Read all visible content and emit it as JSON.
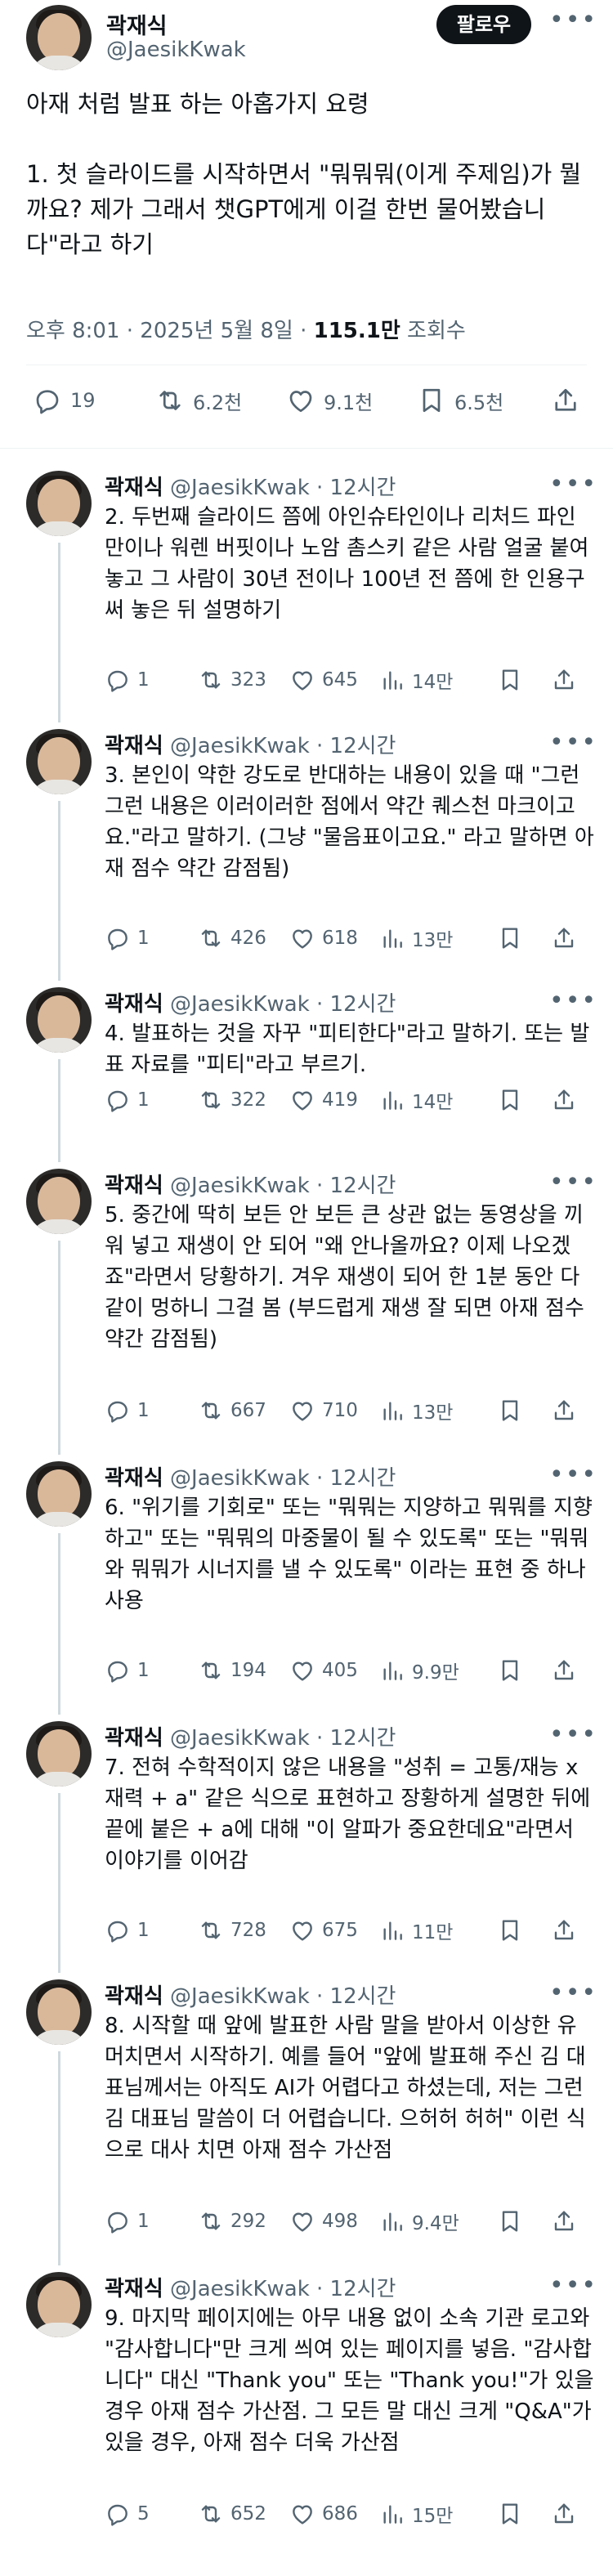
{
  "main_tweet": {
    "author_name": "곽재식",
    "author_handle": "@JaesikKwak",
    "follow_label": "팔로우",
    "text": "아재 처럼 발표 하는 아홉가지 요령\n\n1. 첫 슬라이드를 시작하면서 \"뭐뭐뭐(이게 주제임)가 뭘까요? 제가 그래서 챗GPT에게 이걸 한번 물어봤습니다\"라고 하기",
    "time": "오후 8:01 · 2025년 5월 8일 · ",
    "views": "115.1만",
    "views_label": " 조회수",
    "replies": "19",
    "retweets": "6.2천",
    "likes": "9.1천",
    "bookmarks": "6.5천"
  },
  "replies": [
    {
      "author_name": "곽재식",
      "meta": " @JaesikKwak · 12시간",
      "text": "2. 두번째 슬라이드 쯤에 아인슈타인이나 리처드 파인만이나 워렌 버핏이나 노암 촘스키 같은 사람 얼굴 붙여 놓고 그 사람이 30년 전이나 100년 전 쯤에 한 인용구 써 놓은 뒤 설명하기",
      "replies": "1",
      "retweets": "323",
      "likes": "645",
      "views": "14만"
    },
    {
      "author_name": "곽재식",
      "meta": " @JaesikKwak · 12시간",
      "text": "3. 본인이 약한 강도로 반대하는 내용이 있을 때 \"그런그런 내용은 이러이러한 점에서 약간 퀘스천 마크이고요.\"라고 말하기. (그냥 \"물음표이고요.\" 라고 말하면 아재 점수 약간 감점됨)",
      "replies": "1",
      "retweets": "426",
      "likes": "618",
      "views": "13만"
    },
    {
      "author_name": "곽재식",
      "meta": " @JaesikKwak · 12시간",
      "text": "4. 발표하는 것을 자꾸 \"피티한다\"라고 말하기. 또는 발표 자료를 \"피티\"라고 부르기.",
      "replies": "1",
      "retweets": "322",
      "likes": "419",
      "views": "14만"
    },
    {
      "author_name": "곽재식",
      "meta": " @JaesikKwak · 12시간",
      "text": "5. 중간에 딱히 보든 안 보든 큰 상관 없는 동영상을 끼워 넣고 재생이 안 되어 \"왜 안나올까요? 이제 나오겠죠\"라면서 당황하기. 겨우 재생이 되어 한 1분 동안 다같이 멍하니 그걸 봄 (부드럽게 재생 잘 되면 아재 점수 약간 감점됨)",
      "replies": "1",
      "retweets": "667",
      "likes": "710",
      "views": "13만"
    },
    {
      "author_name": "곽재식",
      "meta": " @JaesikKwak · 12시간",
      "text": "6. \"위기를 기회로\" 또는 \"뭐뭐는 지양하고 뭐뭐를 지향하고\" 또는 \"뭐뭐의 마중물이 될 수 있도록\" 또는 \"뭐뭐와 뭐뭐가 시너지를 낼 수 있도록\" 이라는 표현 중 하나 사용",
      "replies": "1",
      "retweets": "194",
      "likes": "405",
      "views": "9.9만"
    },
    {
      "author_name": "곽재식",
      "meta": " @JaesikKwak · 12시간",
      "text": "7. 전혀 수학적이지 않은 내용을 \"성취 = 고통/재능 x 재력 + a\" 같은 식으로 표현하고 장황하게 설명한 뒤에 끝에 붙은 + a에 대해 \"이 알파가 중요한데요\"라면서 이야기를 이어감",
      "replies": "1",
      "retweets": "728",
      "likes": "675",
      "views": "11만"
    },
    {
      "author_name": "곽재식",
      "meta": " @JaesikKwak · 12시간",
      "text": "8. 시작할 때 앞에 발표한 사람 말을 받아서 이상한 유머치면서 시작하기. 예를 들어 \"앞에 발표해 주신 김 대표님께서는 아직도 AI가 어렵다고 하셨는데, 저는 그런 김 대표님 말씀이 더 어렵습니다. 으허허 허허\" 이런 식으로 대사 치면 아재 점수 가산점",
      "replies": "1",
      "retweets": "292",
      "likes": "498",
      "views": "9.4만"
    },
    {
      "author_name": "곽재식",
      "meta": " @JaesikKwak · 12시간",
      "text": "9. 마지막 페이지에는 아무 내용 없이 소속 기관 로고와 \"감사합니다\"만 크게 씌여 있는 페이지를 넣음. \"감사합니다\" 대신 \"Thank you\" 또는 \"Thank you!\"가 있을 경우 아재 점수 가산점. 그 모든 말 대신 크게 \"Q&A\"가 있을 경우, 아재 점수 더욱 가산점",
      "replies": "5",
      "retweets": "652",
      "likes": "686",
      "views": "15만"
    }
  ]
}
